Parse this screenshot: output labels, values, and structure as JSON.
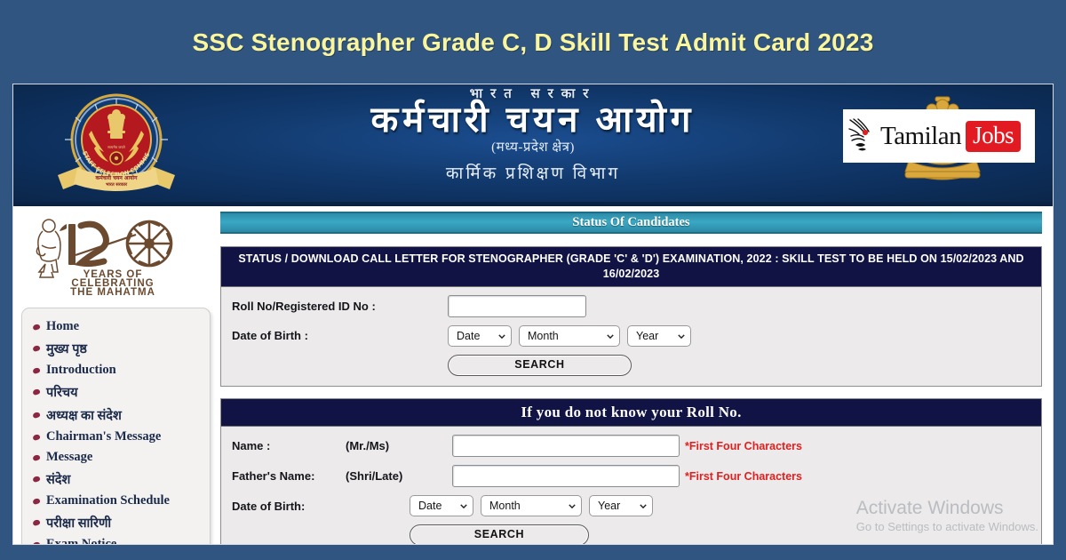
{
  "banner": {
    "title": "SSC Stenographer Grade C, D Skill Test Admit Card 2023",
    "bg_color": "#2f5580",
    "text_color": "#fbf59d"
  },
  "site_header": {
    "emblem_alt": "ssc-emblem",
    "line_bharat": "भारत  सरकार",
    "line_main": "कर्मचारी चयन आयोग",
    "line_region": "(मध्य-प्रदेश क्षेत्र)",
    "line_dept": "कार्मिक प्रशिक्षण विभाग",
    "logo": {
      "word": "Tamilan",
      "badge": "Jobs",
      "badge_color": "#e21b23"
    }
  },
  "sidebar": {
    "gandhi_logo": {
      "number": "150",
      "line1": "YEARS OF",
      "line2": "CELEBRATING",
      "line3": "THE MAHATMA"
    },
    "items": [
      {
        "label": "Home"
      },
      {
        "label": "मुख्य पृष्ठ"
      },
      {
        "label": "Introduction"
      },
      {
        "label": "परिचय"
      },
      {
        "label": "अध्यक्ष का संदेश"
      },
      {
        "label": "Chairman's Message"
      },
      {
        "label": "Message"
      },
      {
        "label": "संदेश"
      },
      {
        "label": "Examination Schedule"
      },
      {
        "label": "परीक्षा सारिणी"
      },
      {
        "label": "Exam Notice"
      }
    ]
  },
  "main": {
    "status_bar": "Status Of Candidates",
    "form1": {
      "heading": "STATUS / DOWNLOAD CALL LETTER FOR STENOGRAPHER (GRADE 'C' & 'D') EXAMINATION, 2022 : SKILL TEST TO BE HELD ON 15/02/2023 AND 16/02/2023",
      "roll_label": "Roll No/Registered ID No :",
      "roll_value": "",
      "roll_placeholder": "",
      "dob_label": "Date of Birth :",
      "date_select": "Date",
      "month_select": "Month",
      "year_select": "Year",
      "search_label": "SEARCH"
    },
    "form2": {
      "heading": "If you do not know your Roll No.",
      "name_label": "Name :",
      "name_prefix": "(Mr./Ms)",
      "name_value": "",
      "name_hint": "*First Four Characters",
      "father_label": "Father's Name:",
      "father_prefix": "(Shri/Late)",
      "father_value": "",
      "father_hint": "*First Four Characters",
      "dob_label": "Date of Birth:",
      "date_select": "Date",
      "month_select": "Month",
      "year_select": "Year",
      "search_label": "SEARCH"
    }
  },
  "watermark": {
    "line1": "Activate Windows",
    "line2": "Go to Settings to activate Windows."
  }
}
